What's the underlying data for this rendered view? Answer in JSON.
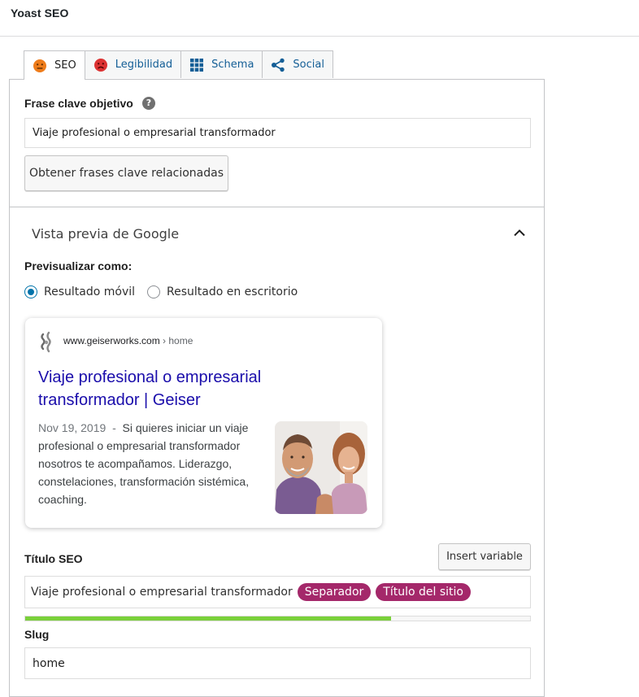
{
  "header": {
    "title": "Yoast SEO"
  },
  "tabs": [
    {
      "label": "SEO",
      "icon": "orange-face-icon"
    },
    {
      "label": "Legibilidad",
      "icon": "red-sad-face-icon"
    },
    {
      "label": "Schema",
      "icon": "grid-icon"
    },
    {
      "label": "Social",
      "icon": "share-icon"
    }
  ],
  "focus_keyphrase": {
    "label": "Frase clave objetivo",
    "help": "?",
    "value": "Viaje profesional o empresarial transformador",
    "related_button": "Obtener frases clave relacionadas"
  },
  "google_preview": {
    "title": "Vista previa de Google",
    "preview_as_label": "Previsualizar como:",
    "options": [
      "Resultado móvil",
      "Resultado en escritorio"
    ],
    "selected": "Resultado móvil",
    "card": {
      "domain": "www.geiserworks.com",
      "breadcrumb": " › home",
      "title": "Viaje profesional o empresarial transformador | Geiser",
      "date": "Nov 19, 2019",
      "separator": "  -  ",
      "description": "Si quieres iniciar un viaje profesional o empresarial transformador nosotros te acompañamos. Liderazgo, constelaciones, transformación sistémica, coaching."
    }
  },
  "seo_title": {
    "label": "Título SEO",
    "insert_button": "Insert variable",
    "text": "Viaje profesional o empresarial transformador",
    "pills": [
      "Separador",
      "Título del sitio"
    ],
    "progress": 0.724
  },
  "slug": {
    "label": "Slug",
    "value": "home"
  },
  "colors": {
    "accent_blue": "#0073aa",
    "pill_purple": "#a4286a",
    "progress_green": "#7ad03a",
    "link_blue": "#1a0dab"
  }
}
